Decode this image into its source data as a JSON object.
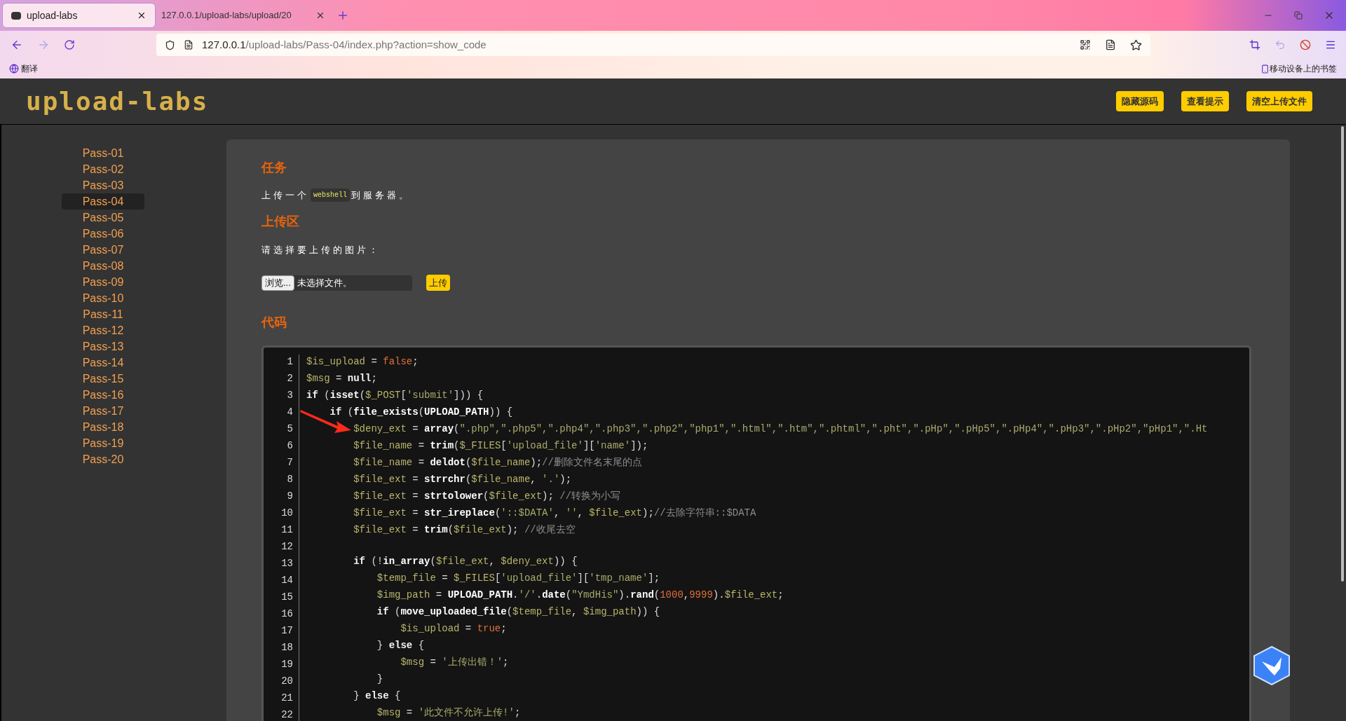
{
  "browser": {
    "tabs": [
      {
        "title": "upload-labs",
        "selected": true
      },
      {
        "title": "127.0.0.1/upload-labs/upload/20",
        "selected": false
      }
    ],
    "url": {
      "host": "127.0.0.1",
      "path": "/upload-labs/Pass-04/index.php?action=show_code"
    },
    "bookmarks": {
      "left": "翻译",
      "right": "移动设备上的书签"
    }
  },
  "header": {
    "logo": "upload-labs",
    "buttons": [
      "隐藏源码",
      "查看提示",
      "清空上传文件"
    ]
  },
  "sidebar": {
    "items": [
      {
        "label": "Pass-01",
        "selected": false
      },
      {
        "label": "Pass-02",
        "selected": false
      },
      {
        "label": "Pass-03",
        "selected": false
      },
      {
        "label": "Pass-04",
        "selected": true
      },
      {
        "label": "Pass-05",
        "selected": false
      },
      {
        "label": "Pass-06",
        "selected": false
      },
      {
        "label": "Pass-07",
        "selected": false
      },
      {
        "label": "Pass-08",
        "selected": false
      },
      {
        "label": "Pass-09",
        "selected": false
      },
      {
        "label": "Pass-10",
        "selected": false
      },
      {
        "label": "Pass-11",
        "selected": false
      },
      {
        "label": "Pass-12",
        "selected": false
      },
      {
        "label": "Pass-13",
        "selected": false
      },
      {
        "label": "Pass-14",
        "selected": false
      },
      {
        "label": "Pass-15",
        "selected": false
      },
      {
        "label": "Pass-16",
        "selected": false
      },
      {
        "label": "Pass-17",
        "selected": false
      },
      {
        "label": "Pass-18",
        "selected": false
      },
      {
        "label": "Pass-19",
        "selected": false
      },
      {
        "label": "Pass-20",
        "selected": false
      }
    ]
  },
  "task": {
    "title": "任务",
    "text_before": "上传一个",
    "code": "webshell",
    "text_after": "到服务器。"
  },
  "upload": {
    "title": "上传区",
    "label": "请选择要上传的图片：",
    "browse_button": "浏览...",
    "file_status": "未选择文件。",
    "submit_button": "上传"
  },
  "code": {
    "title": "代码",
    "lines": [
      {
        "number": "1",
        "tokens": [
          {
            "kind": "var",
            "text": "$is_upload"
          },
          {
            "kind": "op",
            "text": " = "
          },
          {
            "kind": "lit",
            "text": "false"
          },
          {
            "kind": "op",
            "text": ";"
          }
        ]
      },
      {
        "number": "2",
        "tokens": [
          {
            "kind": "var",
            "text": "$msg"
          },
          {
            "kind": "op",
            "text": " = "
          },
          {
            "kind": "kw",
            "text": "null"
          },
          {
            "kind": "op",
            "text": ";"
          }
        ]
      },
      {
        "number": "3",
        "tokens": [
          {
            "kind": "kw",
            "text": "if"
          },
          {
            "kind": "op",
            "text": " ("
          },
          {
            "kind": "fn",
            "text": "isset"
          },
          {
            "kind": "op",
            "text": "("
          },
          {
            "kind": "var",
            "text": "$_POST"
          },
          {
            "kind": "op",
            "text": "["
          },
          {
            "kind": "str",
            "text": "'submit'"
          },
          {
            "kind": "op",
            "text": "])) {"
          }
        ]
      },
      {
        "number": "4",
        "tokens": [
          {
            "kind": "kw",
            "text": "    if"
          },
          {
            "kind": "op",
            "text": " ("
          },
          {
            "kind": "fn",
            "text": "file_exists"
          },
          {
            "kind": "op",
            "text": "("
          },
          {
            "kind": "fn",
            "text": "UPLOAD_PATH"
          },
          {
            "kind": "op",
            "text": ")) {"
          }
        ]
      },
      {
        "number": "5",
        "tokens": [
          {
            "kind": "var",
            "text": "        $deny_ext"
          },
          {
            "kind": "op",
            "text": " = "
          },
          {
            "kind": "fn",
            "text": "array"
          },
          {
            "kind": "op",
            "text": "("
          },
          {
            "kind": "str",
            "text": "\".php\",\".php5\",\".php4\",\".php3\",\".php2\",\"php1\",\".html\",\".htm\",\".phtml\",\".pht\",\".pHp\",\".pHp5\",\".pHp4\",\".pHp3\",\".pHp2\",\"pHp1\",\".Ht"
          }
        ]
      },
      {
        "number": "6",
        "tokens": [
          {
            "kind": "var",
            "text": "        $file_name"
          },
          {
            "kind": "op",
            "text": " = "
          },
          {
            "kind": "fn",
            "text": "trim"
          },
          {
            "kind": "op",
            "text": "("
          },
          {
            "kind": "var",
            "text": "$_FILES"
          },
          {
            "kind": "op",
            "text": "["
          },
          {
            "kind": "str",
            "text": "'upload_file'"
          },
          {
            "kind": "op",
            "text": "]["
          },
          {
            "kind": "str",
            "text": "'name'"
          },
          {
            "kind": "op",
            "text": "]);"
          }
        ]
      },
      {
        "number": "7",
        "tokens": [
          {
            "kind": "var",
            "text": "        $file_name"
          },
          {
            "kind": "op",
            "text": " = "
          },
          {
            "kind": "fn",
            "text": "deldot"
          },
          {
            "kind": "op",
            "text": "("
          },
          {
            "kind": "var",
            "text": "$file_name"
          },
          {
            "kind": "op",
            "text": ");"
          },
          {
            "kind": "cmt",
            "text": "//删除文件名末尾的点"
          }
        ]
      },
      {
        "number": "8",
        "tokens": [
          {
            "kind": "var",
            "text": "        $file_ext"
          },
          {
            "kind": "op",
            "text": " = "
          },
          {
            "kind": "fn",
            "text": "strrchr"
          },
          {
            "kind": "op",
            "text": "("
          },
          {
            "kind": "var",
            "text": "$file_name"
          },
          {
            "kind": "op",
            "text": ", "
          },
          {
            "kind": "str",
            "text": "'.'"
          },
          {
            "kind": "op",
            "text": ");"
          }
        ]
      },
      {
        "number": "9",
        "tokens": [
          {
            "kind": "var",
            "text": "        $file_ext"
          },
          {
            "kind": "op",
            "text": " = "
          },
          {
            "kind": "fn",
            "text": "strtolower"
          },
          {
            "kind": "op",
            "text": "("
          },
          {
            "kind": "var",
            "text": "$file_ext"
          },
          {
            "kind": "op",
            "text": "); "
          },
          {
            "kind": "cmt",
            "text": "//转换为小写"
          }
        ]
      },
      {
        "number": "10",
        "tokens": [
          {
            "kind": "var",
            "text": "        $file_ext"
          },
          {
            "kind": "op",
            "text": " = "
          },
          {
            "kind": "fn",
            "text": "str_ireplace"
          },
          {
            "kind": "op",
            "text": "("
          },
          {
            "kind": "str",
            "text": "'::$DATA'"
          },
          {
            "kind": "op",
            "text": ", "
          },
          {
            "kind": "str",
            "text": "''"
          },
          {
            "kind": "op",
            "text": ", "
          },
          {
            "kind": "var",
            "text": "$file_ext"
          },
          {
            "kind": "op",
            "text": ");"
          },
          {
            "kind": "cmt",
            "text": "//去除字符串::$DATA"
          }
        ]
      },
      {
        "number": "11",
        "tokens": [
          {
            "kind": "var",
            "text": "        $file_ext"
          },
          {
            "kind": "op",
            "text": " = "
          },
          {
            "kind": "fn",
            "text": "trim"
          },
          {
            "kind": "op",
            "text": "("
          },
          {
            "kind": "var",
            "text": "$file_ext"
          },
          {
            "kind": "op",
            "text": "); "
          },
          {
            "kind": "cmt",
            "text": "//收尾去空"
          }
        ]
      },
      {
        "number": "12"
      },
      {
        "number": "13",
        "tokens": [
          {
            "kind": "kw",
            "text": "        if"
          },
          {
            "kind": "op",
            "text": " (!"
          },
          {
            "kind": "fn",
            "text": "in_array"
          },
          {
            "kind": "op",
            "text": "("
          },
          {
            "kind": "var",
            "text": "$file_ext"
          },
          {
            "kind": "op",
            "text": ", "
          },
          {
            "kind": "var",
            "text": "$deny_ext"
          },
          {
            "kind": "op",
            "text": ")) {"
          }
        ]
      },
      {
        "number": "14",
        "tokens": [
          {
            "kind": "var",
            "text": "            $temp_file"
          },
          {
            "kind": "op",
            "text": " = "
          },
          {
            "kind": "var",
            "text": "$_FILES"
          },
          {
            "kind": "op",
            "text": "["
          },
          {
            "kind": "str",
            "text": "'upload_file'"
          },
          {
            "kind": "op",
            "text": "]["
          },
          {
            "kind": "str",
            "text": "'tmp_name'"
          },
          {
            "kind": "op",
            "text": "];"
          }
        ]
      },
      {
        "number": "15",
        "tokens": [
          {
            "kind": "var",
            "text": "            $img_path"
          },
          {
            "kind": "op",
            "text": " = "
          },
          {
            "kind": "fn",
            "text": "UPLOAD_PATH"
          },
          {
            "kind": "op",
            "text": "."
          },
          {
            "kind": "str",
            "text": "'/'"
          },
          {
            "kind": "op",
            "text": "."
          },
          {
            "kind": "fn",
            "text": "date"
          },
          {
            "kind": "op",
            "text": "("
          },
          {
            "kind": "str",
            "text": "\"YmdHis\""
          },
          {
            "kind": "op",
            "text": ")."
          },
          {
            "kind": "fn",
            "text": "rand"
          },
          {
            "kind": "op",
            "text": "("
          },
          {
            "kind": "num",
            "text": "1000"
          },
          {
            "kind": "op",
            "text": ","
          },
          {
            "kind": "num",
            "text": "9999"
          },
          {
            "kind": "op",
            "text": ")."
          },
          {
            "kind": "var",
            "text": "$file_ext"
          },
          {
            "kind": "op",
            "text": ";"
          }
        ]
      },
      {
        "number": "16",
        "tokens": [
          {
            "kind": "kw",
            "text": "            if"
          },
          {
            "kind": "op",
            "text": " ("
          },
          {
            "kind": "fn",
            "text": "move_uploaded_file"
          },
          {
            "kind": "op",
            "text": "("
          },
          {
            "kind": "var",
            "text": "$temp_file"
          },
          {
            "kind": "op",
            "text": ", "
          },
          {
            "kind": "var",
            "text": "$img_path"
          },
          {
            "kind": "op",
            "text": ")) {"
          }
        ]
      },
      {
        "number": "17",
        "tokens": [
          {
            "kind": "var",
            "text": "                $is_upload"
          },
          {
            "kind": "op",
            "text": " = "
          },
          {
            "kind": "lit",
            "text": "true"
          },
          {
            "kind": "op",
            "text": ";"
          }
        ]
      },
      {
        "number": "18",
        "tokens": [
          {
            "kind": "op",
            "text": "            } "
          },
          {
            "kind": "kw",
            "text": "else"
          },
          {
            "kind": "op",
            "text": " {"
          }
        ]
      },
      {
        "number": "19",
        "tokens": [
          {
            "kind": "var",
            "text": "                $msg"
          },
          {
            "kind": "op",
            "text": " = "
          },
          {
            "kind": "str",
            "text": "'上传出错！'"
          },
          {
            "kind": "op",
            "text": ";"
          }
        ]
      },
      {
        "number": "20",
        "tokens": [
          {
            "kind": "op",
            "text": "            }"
          }
        ]
      },
      {
        "number": "21",
        "tokens": [
          {
            "kind": "op",
            "text": "        } "
          },
          {
            "kind": "kw",
            "text": "else"
          },
          {
            "kind": "op",
            "text": " {"
          }
        ]
      },
      {
        "number": "22",
        "tokens": [
          {
            "kind": "var",
            "text": "            $msg"
          },
          {
            "kind": "op",
            "text": " = "
          },
          {
            "kind": "str",
            "text": "'此文件不允许上传!'"
          },
          {
            "kind": "op",
            "text": ";"
          }
        ]
      }
    ]
  }
}
